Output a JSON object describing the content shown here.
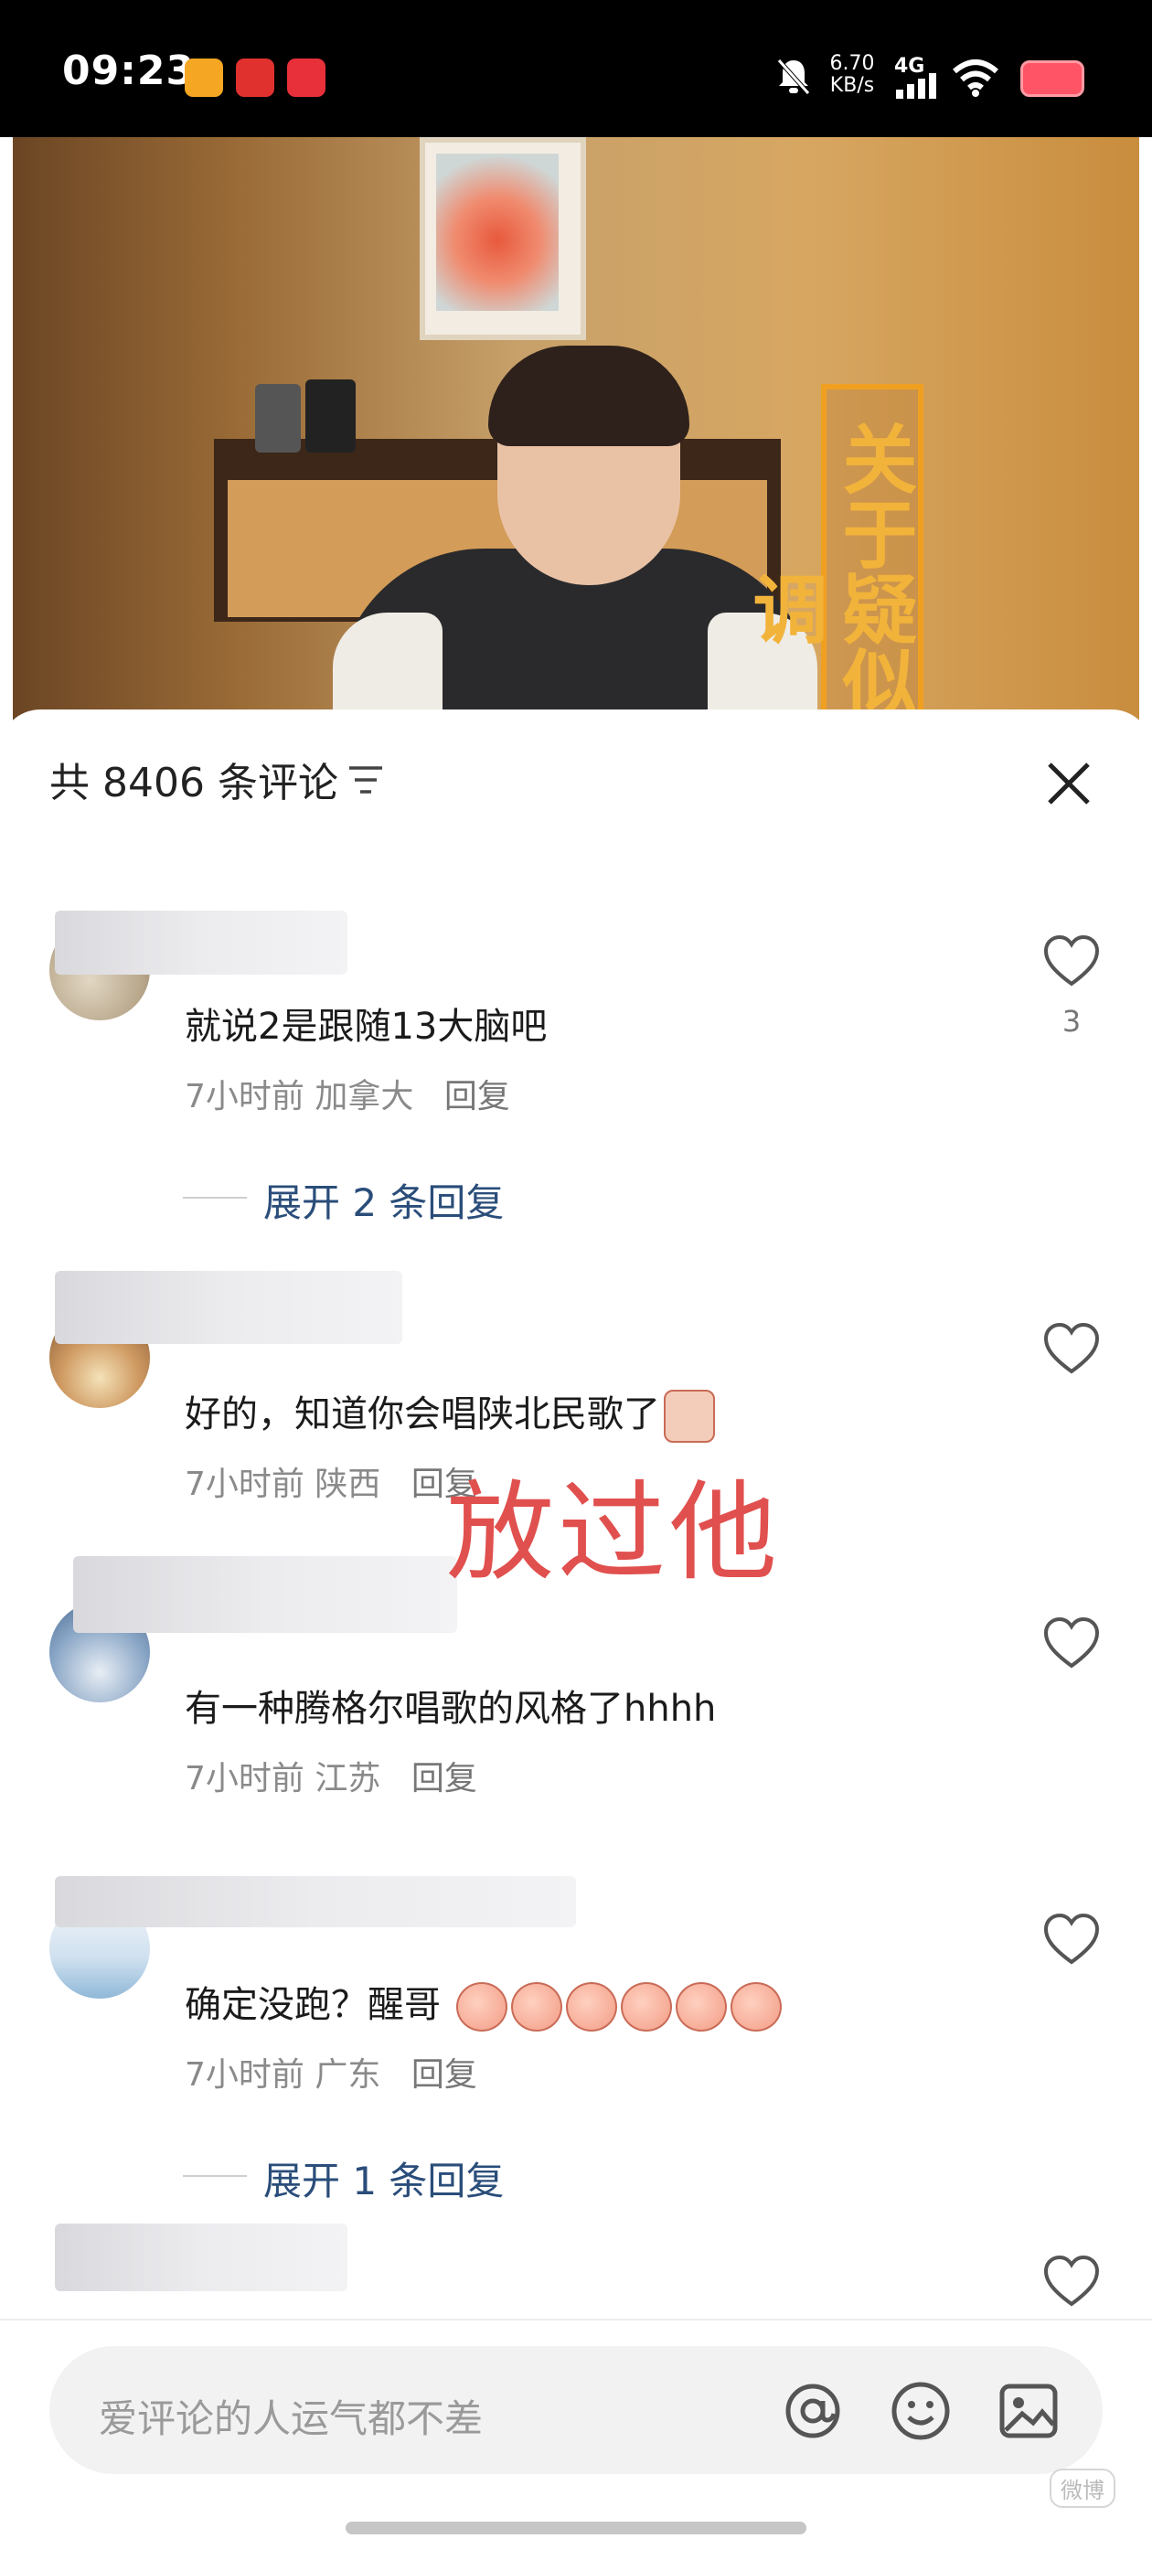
{
  "status_bar": {
    "time": "09:23",
    "speed": "6.70\nKB/s",
    "network": "4G"
  },
  "video": {
    "title": "关于疑似跑调"
  },
  "comments_header": {
    "count_label": "共 8406 条评论"
  },
  "comments": [
    {
      "text": "就说2是跟随13大脑吧",
      "time": "7小时前",
      "location": "加拿大",
      "reply_label": "回复",
      "likes": "3",
      "expand_label": "展开 2 条回复"
    },
    {
      "text": "好的，知道你会唱陕北民歌了",
      "time": "7小时前",
      "location": "陕西",
      "reply_label": "回复",
      "likes": ""
    },
    {
      "text": "有一种腾格尔唱歌的风格了hhhh",
      "time": "7小时前",
      "location": "江苏",
      "reply_label": "回复",
      "likes": ""
    },
    {
      "text": "确定没跑？醒哥",
      "time": "7小时前",
      "location": "广东",
      "reply_label": "回复",
      "likes": "",
      "expand_label": "展开 1 条回复"
    }
  ],
  "overlay_text": "放过他",
  "input": {
    "placeholder": "爱评论的人运气都不差"
  },
  "watermark": "微博"
}
